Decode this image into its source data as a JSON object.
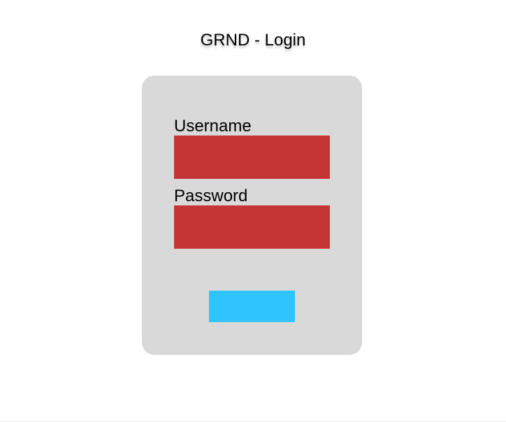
{
  "header": {
    "title": "GRND - Login"
  },
  "form": {
    "username_label": "Username",
    "username_value": "",
    "password_label": "Password",
    "password_value": "",
    "submit_label": ""
  },
  "colors": {
    "card": "#d9d9d9",
    "input": "#c63536",
    "button": "#2fc4fe"
  }
}
